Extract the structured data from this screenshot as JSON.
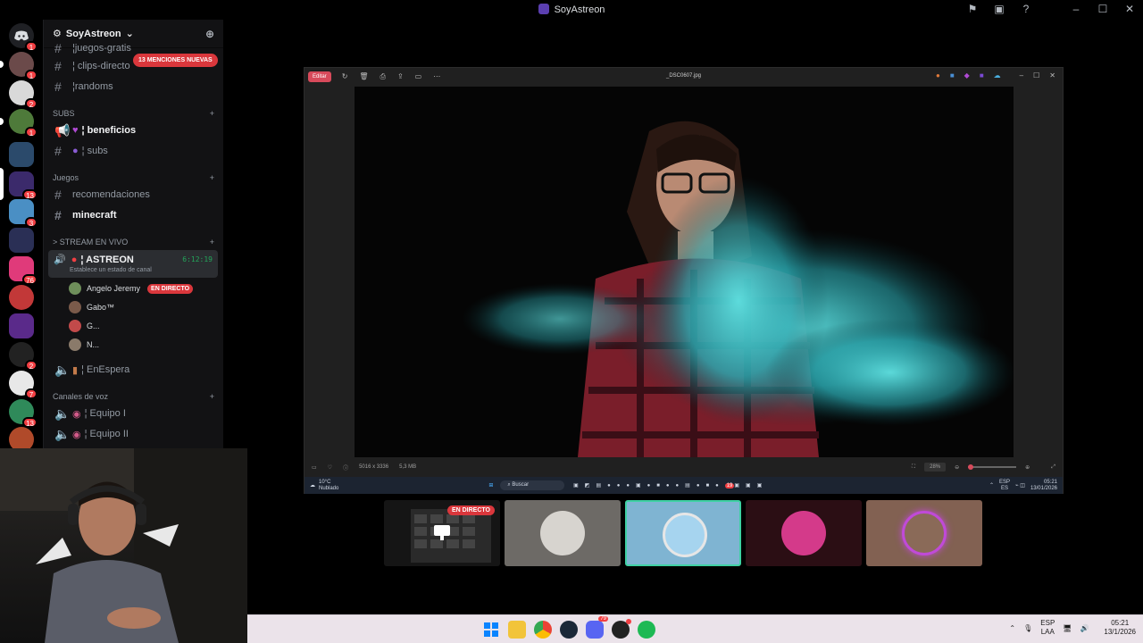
{
  "window": {
    "title": "SoyAstreon"
  },
  "server_badges": [
    "1",
    "1",
    "2",
    "1",
    "13",
    "3",
    "76",
    "2",
    "7",
    "13"
  ],
  "guild": {
    "name": "SoyAstreon"
  },
  "channels_top": [
    {
      "name": "¦juegos-gratis"
    },
    {
      "name": "¦ clips-directo"
    },
    {
      "name": "¦randoms"
    }
  ],
  "mentions_pill": "13 MENCIONES NUEVAS",
  "categories": {
    "subs": "SUBS",
    "juegos": "Juegos",
    "stream": "> STREAM EN VIVO",
    "voz": "Canales de voz"
  },
  "subs_channels": [
    {
      "name": "¦ beneficios"
    },
    {
      "name": "¦ subs"
    }
  ],
  "juegos_channels": [
    {
      "name": "recomendaciones"
    },
    {
      "name": "minecraft"
    }
  ],
  "live_channel": {
    "name": "¦ ASTREON",
    "timer": "6:12:19",
    "status": "Establece un estado de canal"
  },
  "voice_users": [
    {
      "name": "Angelo Jeremy",
      "badge": "EN DIRECTO"
    },
    {
      "name": "Gabo™"
    },
    {
      "name": "G..."
    },
    {
      "name": "N..."
    }
  ],
  "waiting_channel": "¦ EnEspera",
  "voice_channels": [
    {
      "name": "¦ Equipo I"
    },
    {
      "name": "¦ Equipo II"
    }
  ],
  "viewer": {
    "edit_label": "Editar",
    "filename": "_DSC0607.jpg",
    "dimensions": "5016 x 3336",
    "filesize": "5,3 MB",
    "zoom": "28%"
  },
  "inner_taskbar": {
    "weather_temp": "10°C",
    "weather_desc": "Nublado",
    "search": "Buscar",
    "lang1": "ESP",
    "lang2": "ES",
    "time": "05:21",
    "date": "13/01/2026",
    "notif": "19"
  },
  "stream_thumb_label": "EN DIRECTO",
  "taskbar": {
    "lang1": "ESP",
    "lang2": "LAA",
    "time": "05:21",
    "date": "13/1/2026",
    "discord_badge": "79"
  }
}
